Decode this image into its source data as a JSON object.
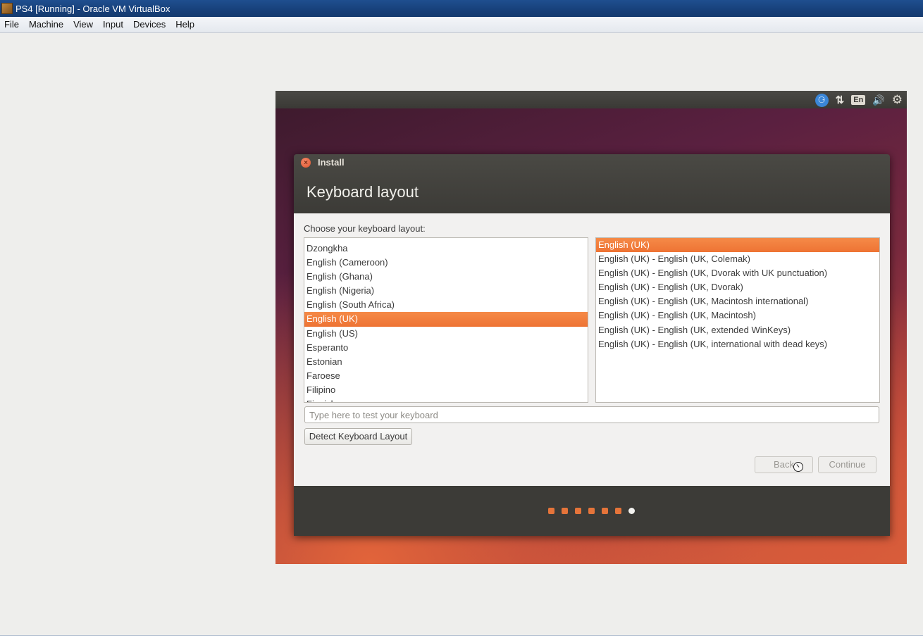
{
  "host": {
    "title": "PS4 [Running] - Oracle VM VirtualBox",
    "menu": [
      "File",
      "Machine",
      "View",
      "Input",
      "Devices",
      "Help"
    ]
  },
  "panel": {
    "keyboard_indicator": "En",
    "icons": [
      "accessibility-icon",
      "network-icon",
      "keyboard-layout-icon",
      "volume-icon",
      "gear-icon"
    ]
  },
  "dialog": {
    "window_title": "Install",
    "page_title": "Keyboard layout",
    "choose_label": "Choose your keyboard layout:",
    "layouts": [
      "Dzongkha",
      "English (Cameroon)",
      "English (Ghana)",
      "English (Nigeria)",
      "English (South Africa)",
      "English (UK)",
      "English (US)",
      "Esperanto",
      "Estonian",
      "Faroese",
      "Filipino",
      "Finnish"
    ],
    "selected_layout": "English (UK)",
    "variants": [
      "English (UK)",
      "English (UK) - English (UK, Colemak)",
      "English (UK) - English (UK, Dvorak with UK punctuation)",
      "English (UK) - English (UK, Dvorak)",
      "English (UK) - English (UK, Macintosh international)",
      "English (UK) - English (UK, Macintosh)",
      "English (UK) - English (UK, extended WinKeys)",
      "English (UK) - English (UK, international with dead keys)"
    ],
    "selected_variant": "English (UK)",
    "test_placeholder": "Type here to test your keyboard",
    "detect_button": "Detect Keyboard Layout",
    "back_button": "Back",
    "continue_button": "Continue",
    "progress": {
      "total_steps": 7,
      "current_step": 7
    }
  },
  "colors": {
    "accent": "#ee7334",
    "panel": "#3c3b37"
  }
}
